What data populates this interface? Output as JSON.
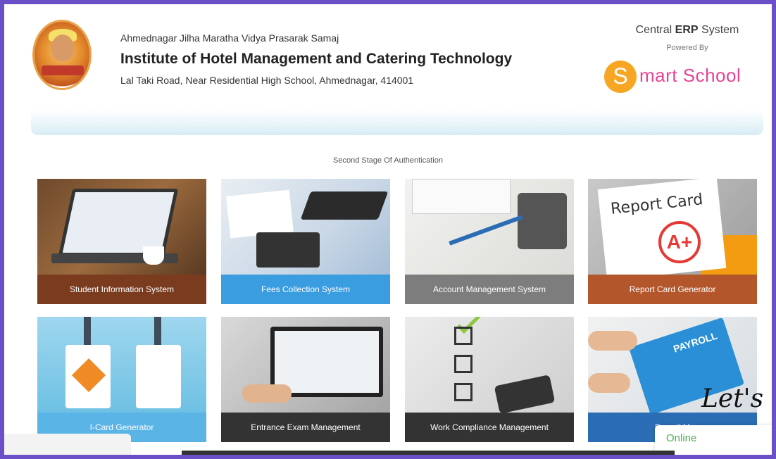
{
  "header": {
    "org_name": "Ahmednagar Jilha Maratha Vidya Prasarak Samaj",
    "institute_name": "Institute of Hotel Management and Catering Technology",
    "address": "Lal Taki Road, Near Residential High School, Ahmednagar, 414001",
    "erp_prefix": "Central",
    "erp_bold": "ERP",
    "erp_suffix": "System",
    "powered_by": "Powered By",
    "brand_letter": "S",
    "brand_rest": "mart School"
  },
  "subtitle": "Second Stage Of Authentication",
  "tiles": [
    {
      "label": "Student Information System"
    },
    {
      "label": "Fees Collection System"
    },
    {
      "label": "Account Management System"
    },
    {
      "label": "Report Card Generator"
    },
    {
      "label": "I-Card Generator"
    },
    {
      "label": "Entrance Exam Management"
    },
    {
      "label": "Work Compliance Management"
    },
    {
      "label": "Payroll M"
    }
  ],
  "report_card_text": "Report Card",
  "report_card_grade": "A+",
  "payroll_text": "PAYROLL",
  "script_text": "Let's ta",
  "chat": {
    "status": "Online"
  },
  "colors": {
    "border": "#6b4fc8",
    "brand_orange": "#f6a623",
    "brand_pink": "#e84393",
    "online_green": "#4caf50"
  }
}
